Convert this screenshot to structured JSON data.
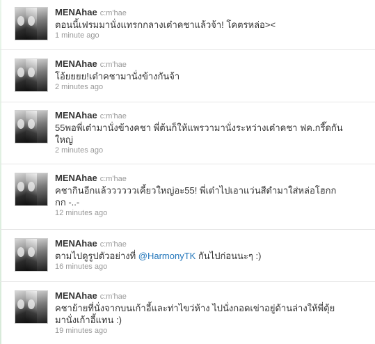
{
  "tweets": [
    {
      "screen_name": "MENAhae",
      "real_name": "c:m'hae",
      "text": "ตอนนี้เฟรมมานั่งแทรกกลางเต๋าคชาแล้วจ้า! โคตรหล่อ><",
      "time": "1 minute ago"
    },
    {
      "screen_name": "MENAhae",
      "real_name": "c:m'hae",
      "text": "โอ้ยยยย!เต๋าคชามานั่งข้างกันจ้า",
      "time": "2 minutes ago"
    },
    {
      "screen_name": "MENAhae",
      "real_name": "c:m'hae",
      "text_line1": "55พอพี่เต๋ามานั่งข้างคชา พี่ต้นก็ให้แพรวามานั่งระหว่างเต๋าคชา ฟค.กรี๊ดกัน",
      "text_line2": "ใหญ่",
      "time": "2 minutes ago"
    },
    {
      "screen_name": "MENAhae",
      "real_name": "c:m'hae",
      "text_line1": "คชากินอีกแล้ววววววเคี้ยวใหญ่อะ55! พี่เต๋าไปเอาแว่นสีดำมาใส่หล่อโฮกก",
      "text_line2": "กก -..-",
      "time": "12 minutes ago"
    },
    {
      "screen_name": "MENAhae",
      "real_name": "c:m'hae",
      "text_before": "ตามไปดูรูปตัวอย่างที่ ",
      "mention": "@HarmonyTK",
      "text_after": " กันไปก่อนนะๆ :)",
      "time": "16 minutes ago"
    },
    {
      "screen_name": "MENAhae",
      "real_name": "c:m'hae",
      "text_line1": "คชาย้ายที่นั่งจากบนเก้าอี้และท่าไขว่ห้าง ไปนั่งกอดเข่าอยู่ด้านล่างให้พี่ตุ้ย",
      "text_line2": "มานั่งเก้าอี้แทน :)",
      "time": "19 minutes ago"
    }
  ],
  "colors": {
    "screen_name": "#333333",
    "meta": "#999999",
    "mention": "#2276bb",
    "divider": "#e6e6e6"
  }
}
